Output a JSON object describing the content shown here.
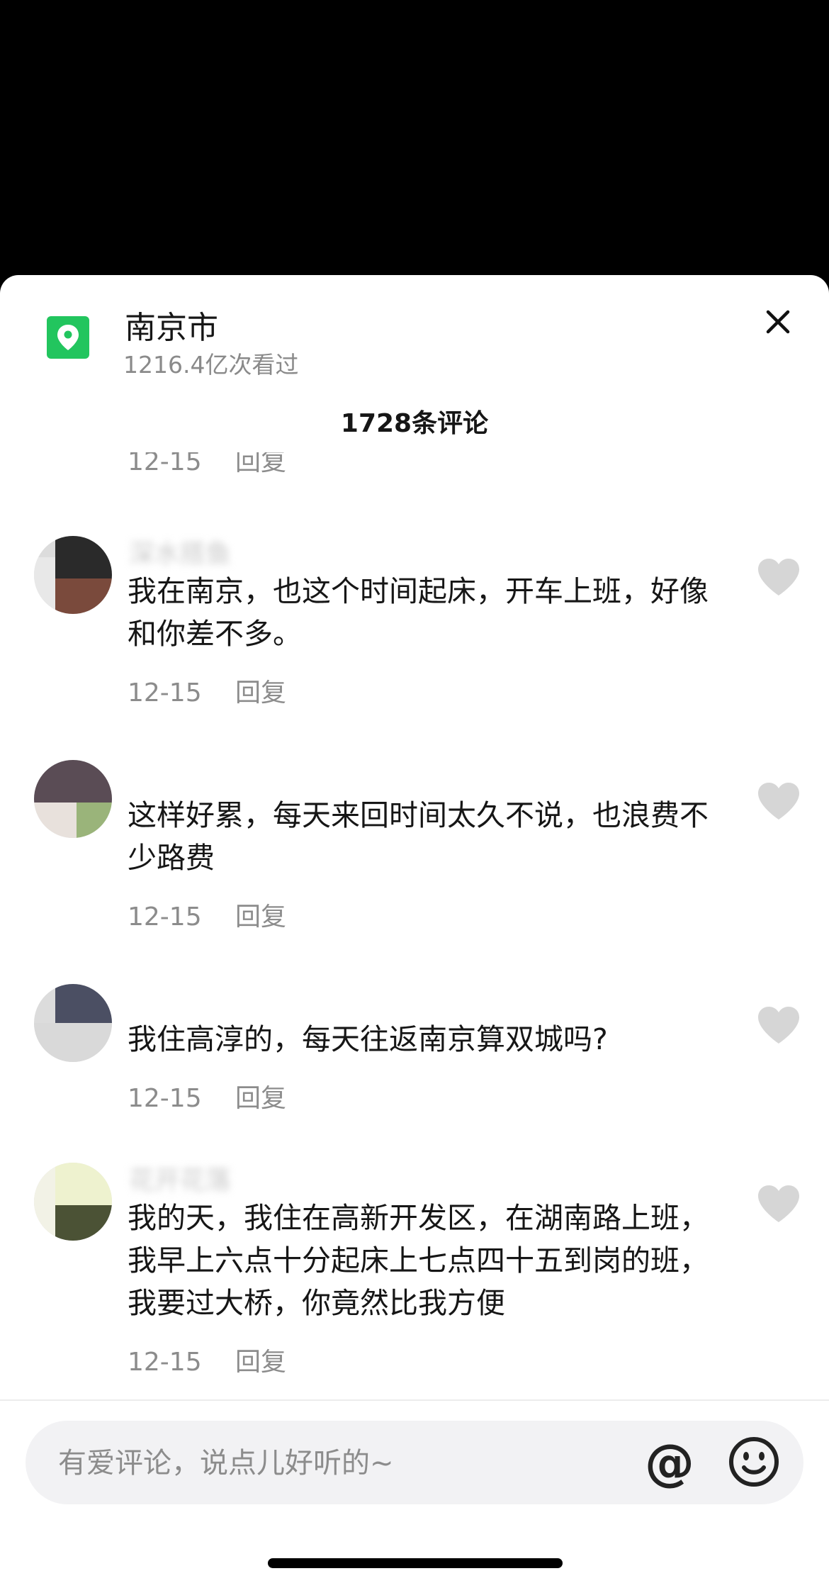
{
  "location": {
    "name": "南京市",
    "views": "1216.4亿次看过",
    "icon": "location-pin-icon"
  },
  "comment_count": "1728条评论",
  "cut_meta": {
    "date": "12-15",
    "reply": "回复"
  },
  "comments": [
    {
      "username": "深水搭鱼",
      "text": "我在南京，也这个时间起床，开车上班，好像和你差不多。",
      "date": "12-15",
      "reply": "回复"
    },
    {
      "username": "",
      "text": "这样好累，每天来回时间太久不说，也浪费不少路费",
      "date": "12-15",
      "reply": "回复"
    },
    {
      "username": "",
      "text": "我住高淳的，每天往返南京算双城吗?",
      "date": "12-15",
      "reply": "回复"
    },
    {
      "username": "花开花落",
      "text": "我的天，我住在高新开发区，在湖南路上班，我早上六点十分起床上七点四十五到岗的班，我要过大桥，你竟然比我方便",
      "date": "12-15",
      "reply": "回复"
    }
  ],
  "input": {
    "placeholder": "有爱评论，说点儿好听的~",
    "value": ""
  },
  "colors": {
    "accent": "#22c55e",
    "like": "#d6d6d6"
  }
}
